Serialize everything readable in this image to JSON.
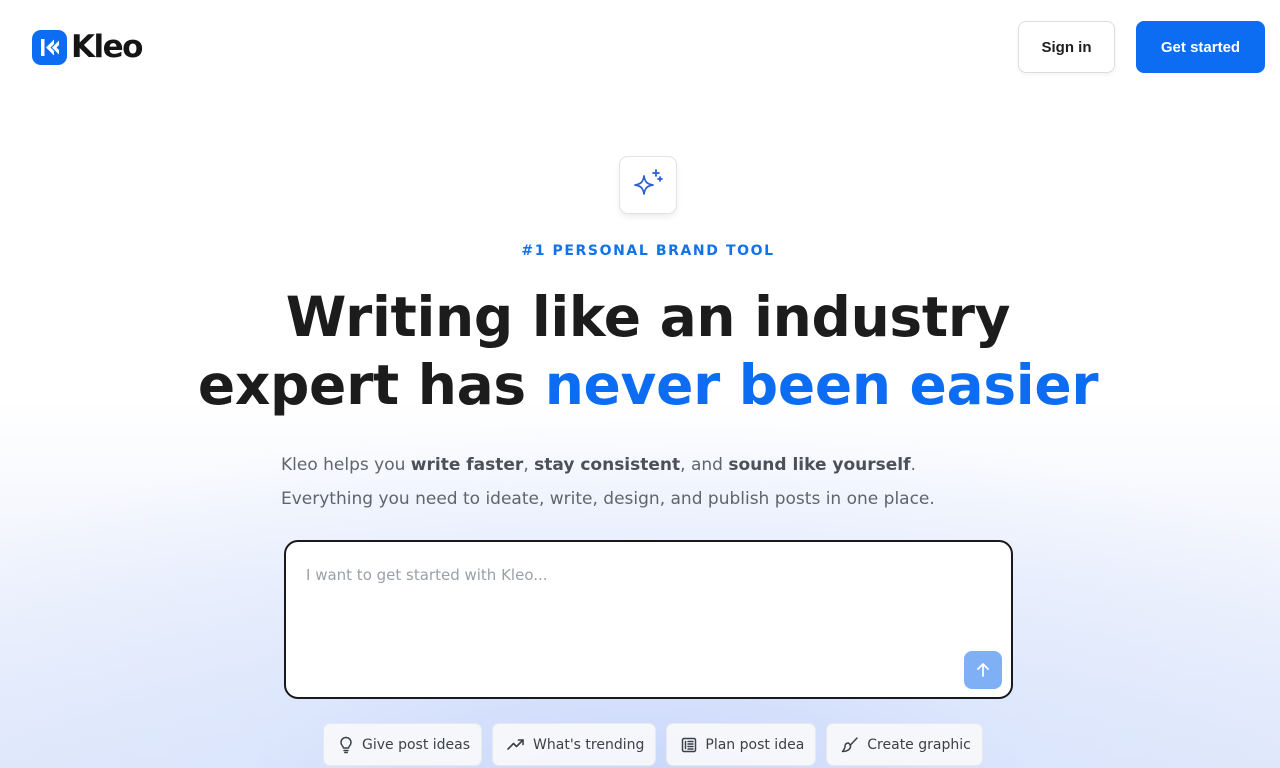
{
  "header": {
    "brand": "Kleo",
    "sign_in_label": "Sign in",
    "get_started_label": "Get started"
  },
  "hero": {
    "icon": "sparkles-icon",
    "eyebrow": "#1 PERSONAL BRAND TOOL",
    "headline_line1": "Writing like an industry",
    "headline_line2_plain": "expert has ",
    "headline_line2_accent": "never been easier",
    "sub_line1_prefix": "Kleo helps you ",
    "sub_line1_b1": "write faster",
    "sub_line1_sep1": ", ",
    "sub_line1_b2": "stay consistent",
    "sub_line1_sep2": ", and ",
    "sub_line1_b3": "sound like yourself",
    "sub_line1_end": ".",
    "sub_line2": "Everything you need to ideate, write, design, and publish posts in one place."
  },
  "composer": {
    "value": "",
    "placeholder": "I want to get started with Kleo...",
    "send_icon": "arrow-up-icon"
  },
  "chips": [
    {
      "label": "Give post ideas",
      "icon": "lightbulb-icon"
    },
    {
      "label": "What's trending",
      "icon": "trending-up-icon"
    },
    {
      "label": "Plan post idea",
      "icon": "newspaper-icon"
    },
    {
      "label": "Create graphic",
      "icon": "paintbrush-icon"
    }
  ],
  "colors": {
    "accent": "#0c6cf2",
    "send_button": "#7fb0f6",
    "headline": "#1c1c1c",
    "body_text": "#60646c"
  }
}
